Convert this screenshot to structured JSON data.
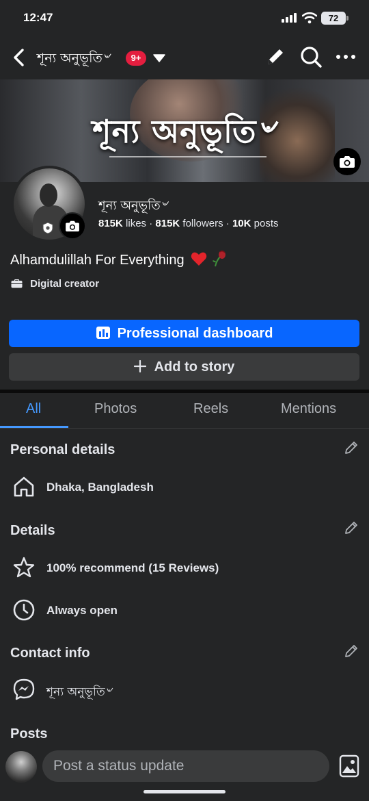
{
  "status_bar": {
    "time": "12:47",
    "battery": "72"
  },
  "topnav": {
    "page_name": "শূন্য অনুভূতি৺",
    "notification_badge": "9+"
  },
  "cover": {
    "title": "শূন্য অনুভূতি৺"
  },
  "profile": {
    "name": "শূন্য অনুভূতি৺",
    "likes_count": "815K",
    "likes_label": "likes",
    "followers_count": "815K",
    "followers_label": "followers",
    "posts_count": "10K",
    "posts_label": "posts",
    "bio": "Alhamdulillah For Everything",
    "category": "Digital creator"
  },
  "buttons": {
    "dashboard": "Professional dashboard",
    "add_story": "Add to story"
  },
  "tabs": [
    "All",
    "Photos",
    "Reels",
    "Mentions"
  ],
  "personal_details": {
    "title": "Personal details",
    "location": "Dhaka, Bangladesh"
  },
  "details": {
    "title": "Details",
    "recommend": "100% recommend (15 Reviews)",
    "hours": "Always open"
  },
  "contact_info": {
    "title": "Contact info",
    "messenger": "শূন্য অনুভূতি৺"
  },
  "posts": {
    "title": "Posts",
    "composer_placeholder": "Post a status update"
  },
  "colors": {
    "accent": "#0866ff",
    "tab_active": "#4599ff",
    "background": "#242526",
    "badge": "#e41e3f"
  }
}
